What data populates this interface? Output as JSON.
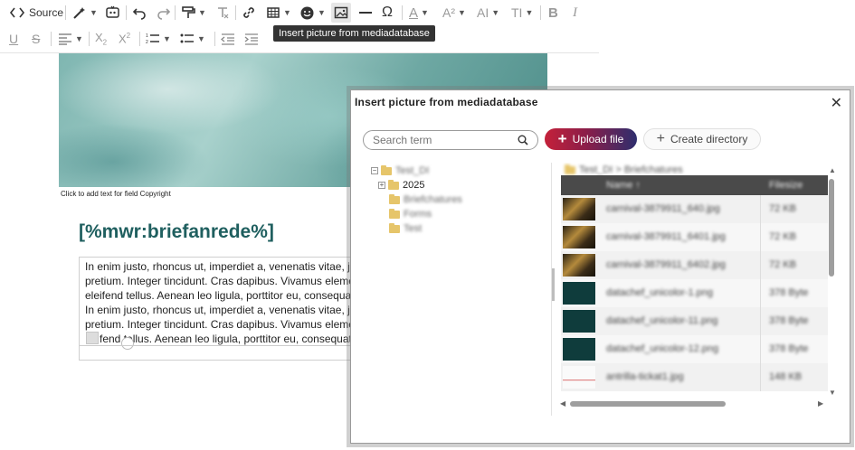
{
  "toolbar": {
    "source_label": "Source",
    "tooltip": "Insert picture from mediadatabase"
  },
  "editor": {
    "copyright_hint": "Click to add text for field Copyright",
    "salutation": "[%mwr:briefanrede%]",
    "lines": [
      "In enim justo, rhoncus ut, imperdiet a, venenatis vitae, justo. N",
      "pretium. Integer tincidunt. Cras dapibus. Vivamus elementum",
      "eleifend tellus. Aenean leo ligula, porttitor eu, consequat vitae",
      "In enim justo, rhoncus ut, imperdiet a, venenatis vitae, justo. N",
      "pretium. Integer tincidunt. Cras dapibus. Vivamus elementum",
      "fend tellus. Aenean leo ligula, porttitor eu, consequat vitae"
    ]
  },
  "dialog": {
    "title": "Insert picture from mediadatabase",
    "search_placeholder": "Search term",
    "upload_label": "Upload file",
    "create_dir_label": "Create directory",
    "tree": {
      "root": "Test_DI",
      "year": "2025",
      "folders": [
        "Briefchatures",
        "Forms",
        "Test"
      ]
    },
    "breadcrumb": "Test_DI > Briefchatures",
    "columns": {
      "name": "Name ↑",
      "filesize": "Filesize"
    },
    "files": [
      {
        "name": "carnival-3879911_640.jpg",
        "size": "72 KB",
        "thumb": "dark"
      },
      {
        "name": "carnival-3879911_6401.jpg",
        "size": "72 KB",
        "thumb": "dark"
      },
      {
        "name": "carnival-3879911_6402.jpg",
        "size": "72 KB",
        "thumb": "dark"
      },
      {
        "name": "datachef_unicolor-1.png",
        "size": "378 Byte",
        "thumb": "teal"
      },
      {
        "name": "datachef_unicolor-11.png",
        "size": "378 Byte",
        "thumb": "teal"
      },
      {
        "name": "datachef_unicolor-12.png",
        "size": "378 Byte",
        "thumb": "teal"
      },
      {
        "name": "antrilla-tickat1.jpg",
        "size": "148 KB",
        "thumb": "light"
      }
    ]
  },
  "colors": {
    "salutation": "#1f5f5f",
    "upload_gradient_start": "#c4213a",
    "upload_gradient_end": "#2e2e6e",
    "table_header": "#4a4a4a"
  }
}
